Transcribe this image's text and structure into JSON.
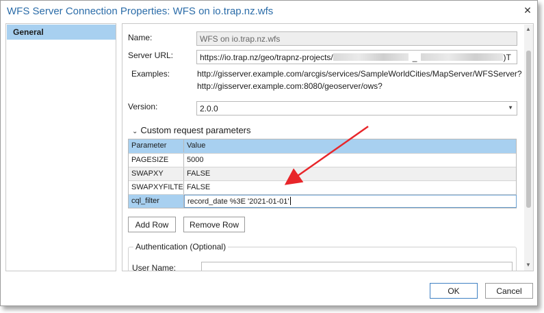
{
  "window": {
    "title": "WFS Server Connection Properties: WFS on io.trap.nz.wfs"
  },
  "sidebar": {
    "items": [
      {
        "label": "General"
      }
    ]
  },
  "form": {
    "name_label": "Name:",
    "name_value": "WFS on io.trap.nz.wfs",
    "url_label": "Server URL:",
    "url_value_prefix": "https://io.trap.nz/geo/trapnz-projects/",
    "url_value_mid": "_",
    "url_value_suffix": ")T",
    "examples_label": "Examples:",
    "examples": [
      "http://gisserver.example.com/arcgis/services/SampleWorldCities/MapServer/WFSServer?",
      "http://gisserver.example.com:8080/geoserver/ows?"
    ],
    "version_label": "Version:",
    "version_value": "2.0.0"
  },
  "params": {
    "section_title": "Custom request parameters",
    "headers": {
      "parameter": "Parameter",
      "value": "Value"
    },
    "rows": [
      {
        "parameter": "PAGESIZE",
        "value": "5000"
      },
      {
        "parameter": "SWAPXY",
        "value": "FALSE"
      },
      {
        "parameter": "SWAPXYFILTER",
        "value": "FALSE"
      },
      {
        "parameter": "cql_filter",
        "value": "record_date %3E '2021-01-01'"
      }
    ],
    "add_row_label": "Add Row",
    "remove_row_label": "Remove Row"
  },
  "auth": {
    "title": "Authentication (Optional)",
    "user_label": "User Name:"
  },
  "footer": {
    "ok_label": "OK",
    "cancel_label": "Cancel"
  },
  "colors": {
    "accent": "#2b6ca8",
    "selection": "#a8d0f0",
    "annotation_arrow": "#e8262a"
  }
}
